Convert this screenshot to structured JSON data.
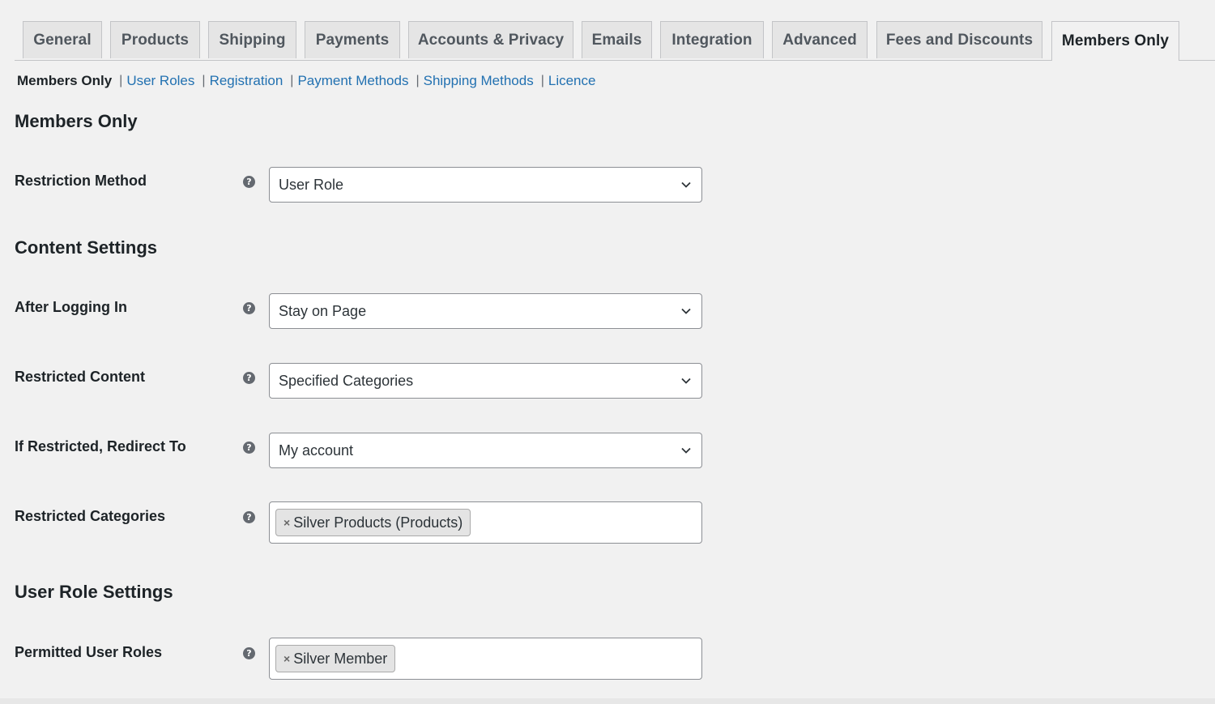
{
  "tabs": [
    {
      "label": "General"
    },
    {
      "label": "Products"
    },
    {
      "label": "Shipping"
    },
    {
      "label": "Payments"
    },
    {
      "label": "Accounts & Privacy"
    },
    {
      "label": "Emails"
    },
    {
      "label": "Integration"
    },
    {
      "label": "Advanced"
    },
    {
      "label": "Fees and Discounts"
    },
    {
      "label": "Members Only"
    }
  ],
  "subnav": {
    "current": "Members Only",
    "separator": "|",
    "links": [
      "User Roles",
      "Registration",
      "Payment Methods",
      "Shipping Methods",
      "Licence"
    ]
  },
  "sections": {
    "members_only": "Members Only",
    "content_settings": "Content Settings",
    "user_role_settings": "User Role Settings"
  },
  "fields": {
    "restriction_method": {
      "label": "Restriction Method",
      "value": "User Role"
    },
    "after_logging_in": {
      "label": "After Logging In",
      "value": "Stay on Page"
    },
    "restricted_content": {
      "label": "Restricted Content",
      "value": "Specified Categories"
    },
    "redirect_to": {
      "label": "If Restricted, Redirect To",
      "value": "My account"
    },
    "restricted_categories": {
      "label": "Restricted Categories",
      "chips": [
        "Silver Products (Products)"
      ]
    },
    "permitted_user_roles": {
      "label": "Permitted User Roles",
      "chips": [
        "Silver Member"
      ]
    }
  },
  "help_glyph": "?",
  "chip_remove_glyph": "×",
  "colors": {
    "link": "#2271b1",
    "page_bg": "#f1f1f1",
    "help_icon": "#646970"
  }
}
